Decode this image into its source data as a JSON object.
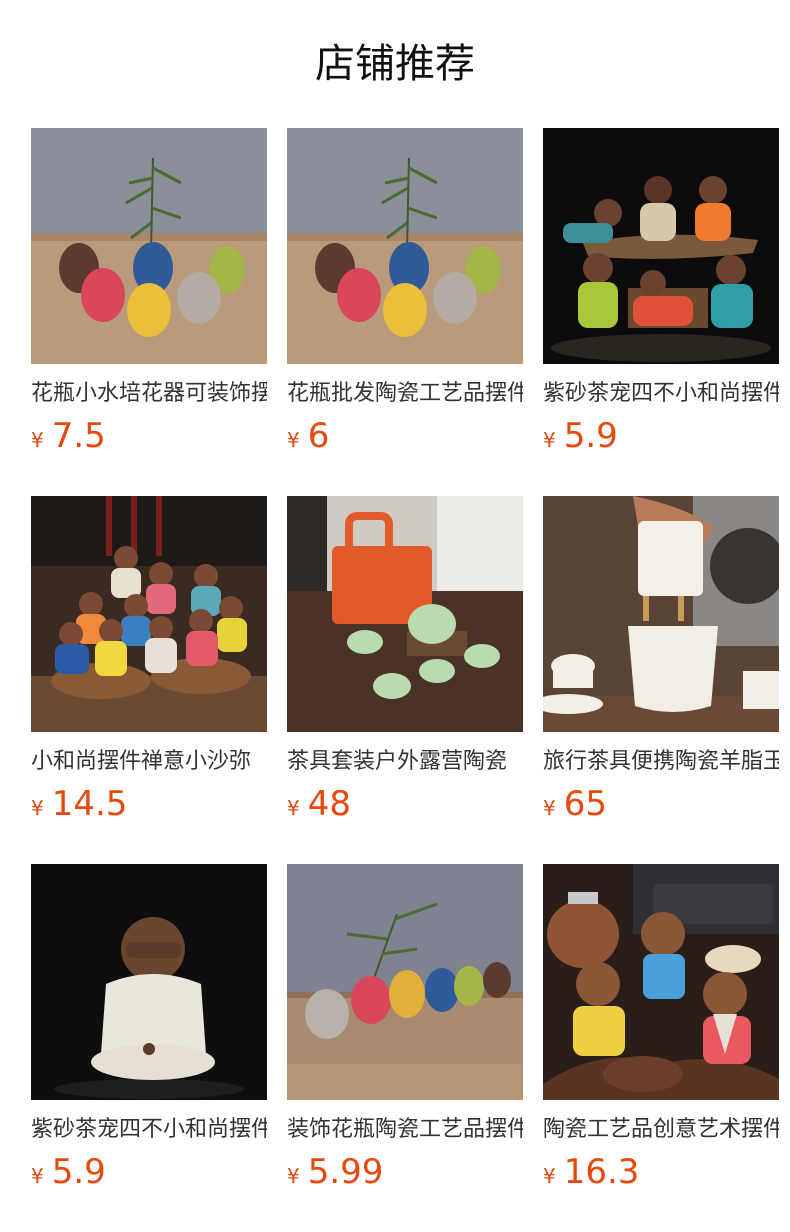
{
  "header": {
    "title": "店铺推荐"
  },
  "currency_symbol": "¥",
  "products": [
    {
      "name": "花瓶小水培花器可装饰摆件",
      "price": "7.5",
      "image": "vase-set-image"
    },
    {
      "name": "花瓶批发陶瓷工艺品摆件",
      "price": "6",
      "image": "vase-set-image"
    },
    {
      "name": "紫砂茶宠四不小和尚摆件",
      "price": "5.9",
      "image": "monk-figurines-image"
    },
    {
      "name": "小和尚摆件禅意小沙弥",
      "price": "14.5",
      "image": "monk-group-image"
    },
    {
      "name": "茶具套装户外露营陶瓷",
      "price": "48",
      "image": "tea-set-image"
    },
    {
      "name": "旅行茶具便携陶瓷羊脂玉",
      "price": "65",
      "image": "tea-infuser-image"
    },
    {
      "name": "紫砂茶宠四不小和尚摆件",
      "price": "5.9",
      "image": "monk-figure-image"
    },
    {
      "name": "装饰花瓶陶瓷工艺品摆件",
      "price": "5.99",
      "image": "vase-row-image"
    },
    {
      "name": "陶瓷工艺品创意艺术摆件",
      "price": "16.3",
      "image": "elder-figurines-image"
    }
  ]
}
